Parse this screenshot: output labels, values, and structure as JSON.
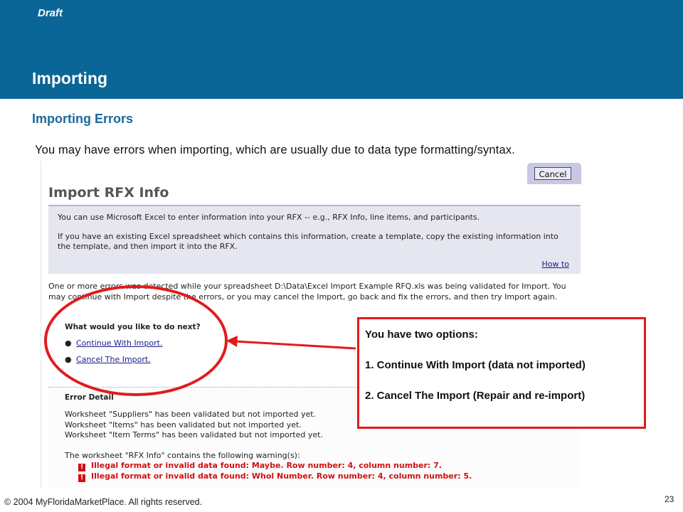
{
  "slide": {
    "draft_label": "Draft",
    "title": "Importing",
    "subtitle": "Importing Errors",
    "intro": "You may have errors when importing, which are usually due to data type formatting/syntax.",
    "footer": "© 2004 MyFloridaMarketPlace. All rights reserved.",
    "page_number": "23"
  },
  "screenshot": {
    "cancel_label": "Cancel",
    "title": "Import RFX Info",
    "info_line1": "You can use Microsoft Excel to enter information into your RFX -- e.g., RFX Info, line items, and participants.",
    "info_line2": "If you have an existing Excel spreadsheet which contains this information, create a template, copy the existing information into the template, and then import it into the RFX.",
    "how_to": "How to",
    "error_message": "One or more errors was detected while your spreadsheet D:\\Data\\Excel Import Example RFQ.xls was being validated for Import. You may continue with Import despite the errors, or you may cancel the Import, go back and fix the errors, and then try Import again.",
    "next_question": "What would you like to do next?",
    "options": [
      "Continue With Import.",
      "Cancel The Import."
    ],
    "bullet": "●",
    "error_detail_title": "Error Detail",
    "worksheet_lines": [
      "Worksheet \"Suppliers\" has been validated but not imported yet.",
      "Worksheet \"Items\" has been validated but not imported yet.",
      "Worksheet \"Item Terms\" has been validated but not imported yet."
    ],
    "warning_intro": "The worksheet \"RFX Info\" contains the following warning(s):",
    "warning_icon": "!",
    "warnings": [
      "Illegal format or invalid data found: Maybe. Row number: 4, column number: 7.",
      "Illegal format or invalid data found: Whol Number. Row number: 4, column number: 5."
    ]
  },
  "callout": {
    "line1": "You have two options:",
    "line2": "1. Continue With Import (data not imported)",
    "line3": "2. Cancel The Import (Repair and re-import)"
  },
  "colors": {
    "banner": "#0a6696",
    "subtitle": "#1a6b9a",
    "highlight": "#e31a1a",
    "warning": "#d11010",
    "link": "#1a1a8c",
    "panel": "#e6e6f1"
  }
}
